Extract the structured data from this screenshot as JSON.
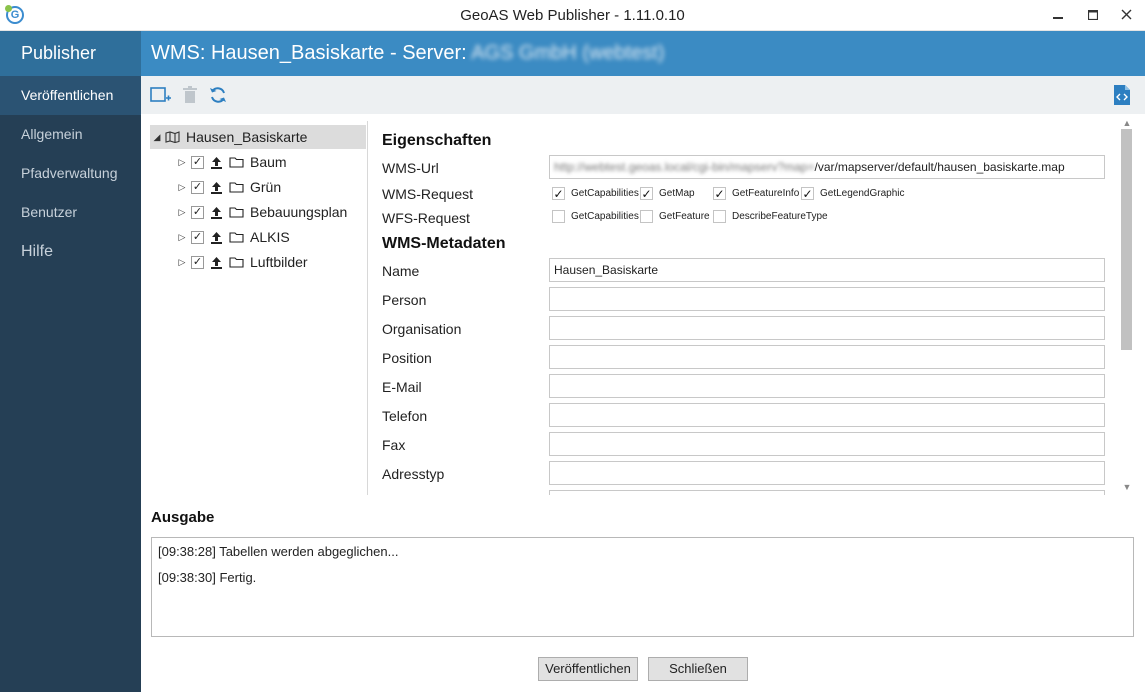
{
  "window": {
    "title": "GeoAS Web Publisher - 1.11.0.10",
    "app_icon_letter": "G",
    "minimize": "‒",
    "maximize": "▢",
    "close": "✕"
  },
  "sidebar": {
    "brand": "Publisher",
    "items": [
      {
        "label": "Veröffentlichen",
        "active": true
      },
      {
        "label": "Allgemein"
      },
      {
        "label": "Pfadverwaltung"
      },
      {
        "label": "Benutzer"
      },
      {
        "label": "Hilfe"
      }
    ]
  },
  "header": {
    "title_prefix": "WMS: Hausen_Basiskarte - Server:",
    "server_blurred": "AGS GmbH (webtest)"
  },
  "toolbar": {
    "icons": [
      "add-icon",
      "delete-icon",
      "refresh-icon",
      "code-file-icon"
    ]
  },
  "tree": {
    "root": "Hausen_Basiskarte",
    "children": [
      {
        "label": "Baum",
        "checked": true
      },
      {
        "label": "Grün",
        "checked": true
      },
      {
        "label": "Bebauungsplan",
        "checked": true
      },
      {
        "label": "ALKIS",
        "checked": true
      },
      {
        "label": "Luftbilder",
        "checked": true
      }
    ]
  },
  "properties": {
    "section_title": "Eigenschaften",
    "wms_url_label": "WMS-Url",
    "wms_url_blurred": "http://webtest.geoas.local/cgi-bin/mapserv?map=",
    "wms_url_value": "/var/mapserver/default/hausen_basiskarte.map",
    "wms_request_label": "WMS-Request",
    "wms_requests": [
      {
        "label": "GetCapabilities",
        "checked": true
      },
      {
        "label": "GetMap",
        "checked": true
      },
      {
        "label": "GetFeatureInfo",
        "checked": true
      },
      {
        "label": "GetLegendGraphic",
        "checked": true
      }
    ],
    "wfs_request_label": "WFS-Request",
    "wfs_requests": [
      {
        "label": "GetCapabilities",
        "checked": false
      },
      {
        "label": "GetFeature",
        "checked": false
      },
      {
        "label": "DescribeFeatureType",
        "checked": false
      }
    ],
    "meta_title": "WMS-Metadaten",
    "fields": [
      {
        "label": "Name",
        "value": "Hausen_Basiskarte"
      },
      {
        "label": "Person",
        "value": ""
      },
      {
        "label": "Organisation",
        "value": ""
      },
      {
        "label": "Position",
        "value": ""
      },
      {
        "label": "E-Mail",
        "value": ""
      },
      {
        "label": "Telefon",
        "value": ""
      },
      {
        "label": "Fax",
        "value": ""
      },
      {
        "label": "Adresstyp",
        "value": ""
      }
    ]
  },
  "output": {
    "title": "Ausgabe",
    "lines": [
      "[09:38:28] Tabellen werden abgeglichen...",
      "[09:38:30] Fertig."
    ]
  },
  "footer": {
    "publish_label": "Veröffentlichen",
    "close_label": "Schließen"
  },
  "colors": {
    "sidebar_bg": "#253f55",
    "brand_bg": "#2f6f9b",
    "header_bg": "#3b8bc3",
    "accent": "#2d7fc1"
  }
}
